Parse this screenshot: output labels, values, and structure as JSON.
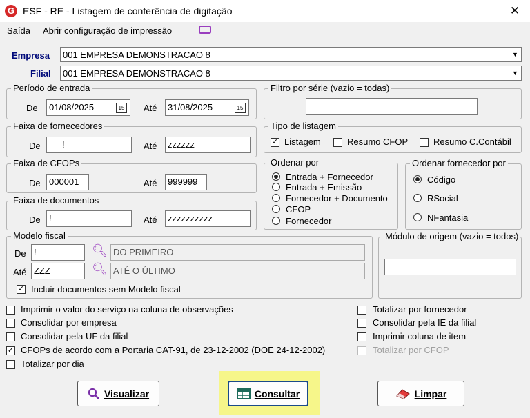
{
  "window": {
    "title": "ESF - RE - Listagem de conferência de digitação",
    "close": "✕",
    "logo": "G"
  },
  "menu": {
    "saida": "Saída",
    "abrir": "Abrir configuração de impressão"
  },
  "empresa": {
    "label": "Empresa",
    "value": "001 EMPRESA DEMONSTRACAO 8"
  },
  "filial": {
    "label": "Filial",
    "value": "001 EMPRESA DEMONSTRACAO 8"
  },
  "periodo": {
    "title": "Período de entrada",
    "de_label": "De",
    "de": "01/08/2025",
    "ate_label": "Até",
    "ate": "31/08/2025",
    "cal": "15"
  },
  "serie": {
    "title": "Filtro por série (vazio = todas)",
    "value": ""
  },
  "fornecedores": {
    "title": "Faixa de fornecedores",
    "de_label": "De",
    "de": "!",
    "ate_label": "Até",
    "ate": "zzzzzz"
  },
  "tipo": {
    "title": "Tipo de listagem",
    "opt1": "Listagem",
    "opt2": "Resumo CFOP",
    "opt3": "Resumo C.Contábil"
  },
  "cfops": {
    "title": "Faixa de CFOPs",
    "de_label": "De",
    "de": "000001",
    "ate_label": "Até",
    "ate": "999999"
  },
  "ordenar": {
    "title": "Ordenar por",
    "o1": "Entrada + Fornecedor",
    "o2": "Entrada + Emissão",
    "o3": "Fornecedor + Documento",
    "o4": "CFOP",
    "o5": "Fornecedor"
  },
  "ordforn": {
    "title": "Ordenar fornecedor por",
    "o1": "Código",
    "o2": "RSocial",
    "o3": "NFantasia"
  },
  "documentos": {
    "title": "Faixa de documentos",
    "de_label": "De",
    "de": "!",
    "ate_label": "Até",
    "ate": "zzzzzzzzzz"
  },
  "modelo": {
    "title": "Modelo fiscal",
    "de_label": "De",
    "de": "!",
    "de_desc": "DO PRIMEIRO",
    "ate_label": "Até",
    "ate": "ZZZ",
    "ate_desc": "ATÉ O ÚLTIMO",
    "incluir": "Incluir documentos sem Modelo fiscal"
  },
  "origem": {
    "title": "Módulo de origem (vazio = todos)",
    "value": ""
  },
  "opts_left": {
    "o1": "Imprimir o valor do serviço na coluna de observações",
    "o2": "Consolidar por empresa",
    "o3": "Consolidar pela UF da filial",
    "o4": "CFOPs de acordo com a Portaria CAT-91, de 23-12-2002 (DOE 24-12-2002)",
    "o5": "Totalizar por dia"
  },
  "opts_right": {
    "o1": "Totalizar por fornecedor",
    "o2": "Consolidar pela IE da filial",
    "o3": "Imprimir coluna de item",
    "o4": "Totalizar por CFOP"
  },
  "buttons": {
    "visualizar": "Visualizar",
    "consultar": "Consultar",
    "limpar": "Limpar"
  },
  "check": "✓",
  "colors": {
    "label_blue": "#000a7a",
    "highlight": "#f6f68a",
    "logo_red": "#d62828"
  }
}
